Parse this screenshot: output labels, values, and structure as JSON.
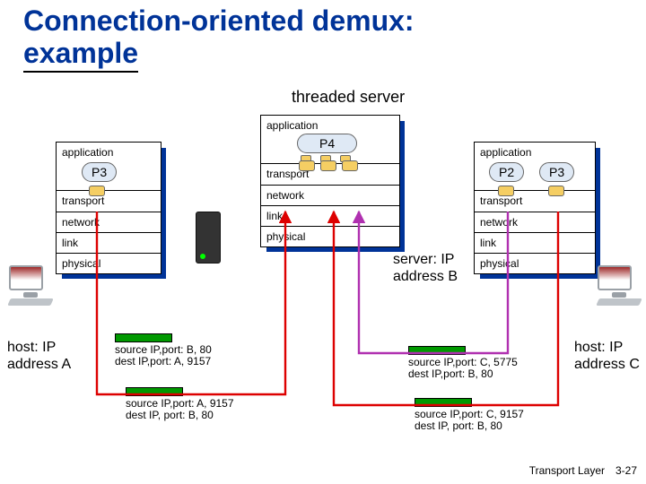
{
  "title_line1": "Connection-oriented demux:",
  "title_line2": "example",
  "threaded_label": "threaded server",
  "hostA": {
    "layers": [
      "application",
      "transport",
      "network",
      "link",
      "physical"
    ],
    "process": "P3",
    "label": "host: IP address A"
  },
  "serverB": {
    "layers": [
      "application",
      "transport",
      "network",
      "link",
      "physical"
    ],
    "process": "P4",
    "label": "server: IP address B"
  },
  "hostC": {
    "layers": [
      "application",
      "transport",
      "network",
      "link",
      "physical"
    ],
    "processes": [
      "P2",
      "P3"
    ],
    "label": "host: IP address C"
  },
  "packets": {
    "a_recv": {
      "l1": "source IP,port: B, 80",
      "l2": "dest IP,port: A, 9157"
    },
    "a_send": {
      "l1": "source IP,port: A, 9157",
      "l2": "dest IP, port: B, 80"
    },
    "c_top": {
      "l1": "source IP,port: C, 5775",
      "l2": "dest IP,port: B, 80"
    },
    "c_bot": {
      "l1": "source IP,port: C, 9157",
      "l2": "dest IP, port: B, 80"
    }
  },
  "footer": "Transport Layer",
  "slide": "3-27"
}
